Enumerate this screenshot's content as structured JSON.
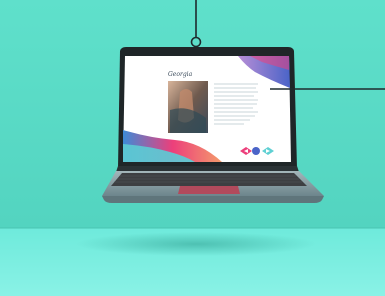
{
  "scene": {
    "background_color": "#5fe0cb",
    "floor_color": "#7fefe0",
    "laptop_body_color": "#8fa6ac",
    "keyboard_color": "#3d3f42",
    "trackpad_color": "#b24a5c",
    "callout_line_color": "#1e2b2e"
  },
  "screen": {
    "page_title": "Georgia",
    "accent_colors": [
      "#4b64c8",
      "#ec3f7b",
      "#5fd0d3",
      "#b88ed6"
    ],
    "nav_icons": [
      "arrow-left-icon",
      "dot-icon",
      "arrow-right-icon"
    ]
  }
}
